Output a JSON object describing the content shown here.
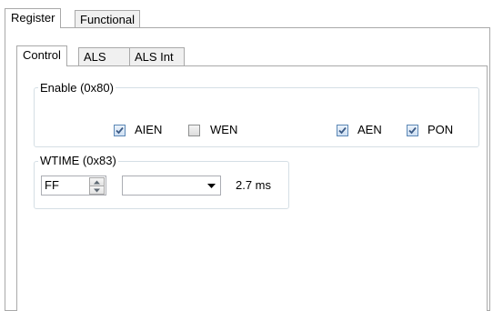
{
  "outer_tabs": [
    {
      "label": "Register",
      "active": true
    },
    {
      "label": "Functional",
      "active": false
    }
  ],
  "inner_tabs": [
    {
      "label": "Control",
      "active": true
    },
    {
      "label": "ALS",
      "active": false
    },
    {
      "label": "ALS Int",
      "active": false
    }
  ],
  "enable_group": {
    "title": "Enable (0x80)",
    "checkboxes": [
      {
        "label": "AIEN",
        "checked": true
      },
      {
        "label": "WEN",
        "checked": false
      },
      {
        "label": "AEN",
        "checked": true
      },
      {
        "label": "PON",
        "checked": true
      }
    ]
  },
  "wtime_group": {
    "title": "WTIME (0x83)",
    "spin_value": "FF",
    "combo_value": "",
    "time_readout": "2.7 ms"
  },
  "icons": {
    "check": "check-mark-icon",
    "spin_up": "triangle-up-icon",
    "spin_down": "triangle-down-icon",
    "dropdown": "dropdown-arrow-icon"
  },
  "colors": {
    "check_mark": "#3b5a85",
    "border": "#a9a9a9",
    "group_border": "#d5dfe5"
  }
}
